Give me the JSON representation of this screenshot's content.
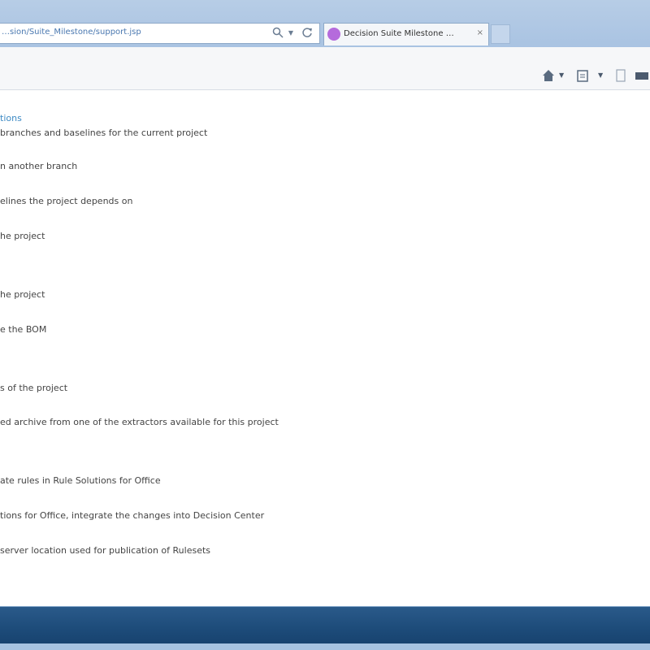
{
  "browser": {
    "address_url": "…sion/Suite_Milestone/support.jsp",
    "address_buttons": {
      "search_icon": "search-icon",
      "refresh_icon": "refresh-icon"
    },
    "tab": {
      "title": "Decision Suite Milestone …",
      "close_glyph": "×"
    },
    "command_icons": [
      "home-icon",
      "feed-icon",
      "print-icon",
      "page-icon"
    ]
  },
  "page": {
    "heading": "tions",
    "lines": [
      "branches and baselines for the current project",
      "n another branch",
      "elines the project depends on",
      "he project",
      "he project",
      "e the BOM",
      "s of the project",
      "ed archive from one of the extractors available for this project",
      "ate rules in Rule Solutions for Office",
      "tions for Office, integrate the changes into Decision Center",
      "server location used for publication of Rulesets"
    ]
  },
  "colors": {
    "frame": "#b7cde6",
    "link": "#3d8ac4",
    "taskbar": "#1c4a78",
    "tab_favicon": "#b56bdc"
  }
}
